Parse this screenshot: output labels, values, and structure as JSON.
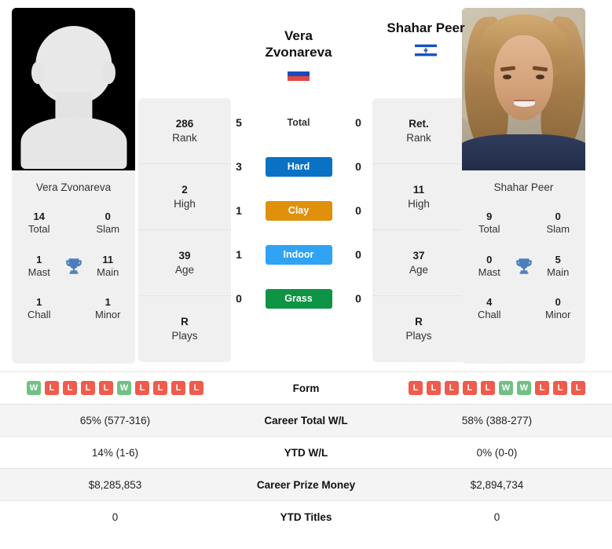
{
  "players": {
    "left": {
      "name": "Vera Zvonareva",
      "name_line1": "Vera",
      "name_line2": "Zvonareva",
      "flag": "russia-flag",
      "photo": "placeholder-silhouette",
      "titles": {
        "total": "14",
        "total_label": "Total",
        "slam": "0",
        "slam_label": "Slam",
        "mast": "1",
        "mast_label": "Mast",
        "main": "11",
        "main_label": "Main",
        "chall": "1",
        "chall_label": "Chall",
        "minor": "1",
        "minor_label": "Minor"
      },
      "stats": [
        {
          "value": "286",
          "label": "Rank"
        },
        {
          "value": "2",
          "label": "High"
        },
        {
          "value": "39",
          "label": "Age"
        },
        {
          "value": "R",
          "label": "Plays"
        }
      ],
      "h2h": {
        "total": "5",
        "hard": "3",
        "clay": "1",
        "indoor": "1",
        "grass": "0"
      },
      "form": [
        "W",
        "L",
        "L",
        "L",
        "L",
        "W",
        "L",
        "L",
        "L",
        "L"
      ],
      "career_wl": "65% (577-316)",
      "ytd_wl": "14% (1-6)",
      "career_prize": "$8,285,853",
      "ytd_titles": "0"
    },
    "right": {
      "name": "Shahar Peer",
      "name_line1": "Shahar Peer",
      "name_line2": "",
      "flag": "israel-flag",
      "photo": "player-portrait",
      "titles": {
        "total": "9",
        "total_label": "Total",
        "slam": "0",
        "slam_label": "Slam",
        "mast": "0",
        "mast_label": "Mast",
        "main": "5",
        "main_label": "Main",
        "chall": "4",
        "chall_label": "Chall",
        "minor": "0",
        "minor_label": "Minor"
      },
      "stats": [
        {
          "value": "Ret.",
          "label": "Rank"
        },
        {
          "value": "11",
          "label": "High"
        },
        {
          "value": "37",
          "label": "Age"
        },
        {
          "value": "R",
          "label": "Plays"
        }
      ],
      "h2h": {
        "total": "0",
        "hard": "0",
        "clay": "0",
        "indoor": "0",
        "grass": "0"
      },
      "form": [
        "L",
        "L",
        "L",
        "L",
        "L",
        "W",
        "W",
        "L",
        "L",
        "L"
      ],
      "career_wl": "58% (388-277)",
      "ytd_wl": "0% (0-0)",
      "career_prize": "$2,894,734",
      "ytd_titles": "0"
    }
  },
  "h2h_rows": [
    {
      "key": "total",
      "label": "Total",
      "color": null,
      "is_bar": false
    },
    {
      "key": "hard",
      "label": "Hard",
      "color": "#0A72C4",
      "is_bar": true
    },
    {
      "key": "clay",
      "label": "Clay",
      "color": "#E0900B",
      "is_bar": true
    },
    {
      "key": "indoor",
      "label": "Indoor",
      "color": "#30A3F5",
      "is_bar": true
    },
    {
      "key": "grass",
      "label": "Grass",
      "color": "#0E9444",
      "is_bar": true
    }
  ],
  "table_rows": [
    {
      "label": "Form",
      "type": "form"
    },
    {
      "label": "Career Total W/L",
      "type": "text",
      "left": "65% (577-316)",
      "right": "58% (388-277)"
    },
    {
      "label": "YTD W/L",
      "type": "text",
      "left": "14% (1-6)",
      "right": "0% (0-0)"
    },
    {
      "label": "Career Prize Money",
      "type": "text",
      "left": "$8,285,853",
      "right": "$2,894,734"
    },
    {
      "label": "YTD Titles",
      "type": "text",
      "left": "0",
      "right": "0"
    }
  ],
  "labels": {
    "form": "Form",
    "career_total_wl": "Career Total W/L",
    "ytd_wl": "YTD W/L",
    "career_prize_money": "Career Prize Money",
    "ytd_titles": "YTD Titles",
    "trophy_icon": "trophy-icon"
  },
  "colors": {
    "hard": "#0A72C4",
    "clay": "#E0900B",
    "indoor": "#30A3F5",
    "grass": "#0E9444",
    "win": "#72c084",
    "loss": "#ef5b4c",
    "card_bg": "#f0f0f0",
    "row_alt": "#f4f4f4"
  }
}
